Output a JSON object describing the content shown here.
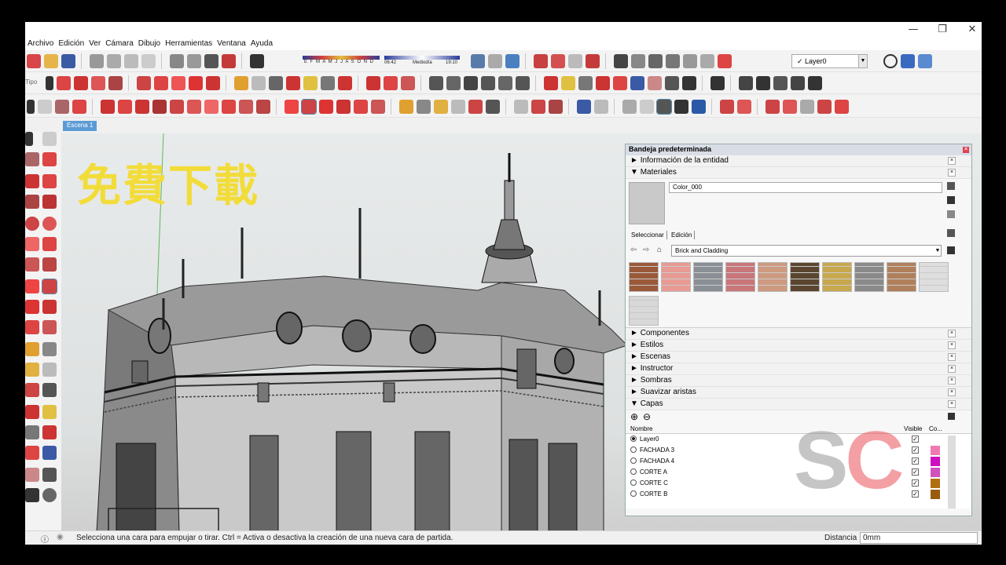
{
  "window": {
    "minimize": "—",
    "restore": "❐",
    "close": "✕"
  },
  "menu": [
    "Archivo",
    "Edición",
    "Ver",
    "Cámara",
    "Dibujo",
    "Herramientas",
    "Ventana",
    "Ayuda"
  ],
  "toolbar": {
    "tipo_label": "Tipo",
    "layer_select": "✓  Layer0",
    "shadow_months": "E F M A M J J A S O N D",
    "shadow_time_start": "06:42",
    "shadow_time_mid": "Mediodía",
    "shadow_time_end": "19:10"
  },
  "scene_tab": "Escena 1",
  "overlay": {
    "promo_text": "免費下載",
    "brand_text_s": "S",
    "brand_text_c": "C"
  },
  "tray": {
    "title": "Bandeja predeterminada",
    "sections": {
      "entity_info": "Información de la entidad",
      "materials": "Materiales",
      "components": "Componentes",
      "styles": "Estilos",
      "scenes": "Escenas",
      "instructor": "Instructor",
      "shadows": "Sombras",
      "soften_edges": "Suavizar aristas",
      "layers": "Capas"
    },
    "materials": {
      "current_name": "Color_000",
      "tab_select": "Seleccionar",
      "tab_edit": "Edición",
      "library": "Brick and Cladding",
      "swatches": [
        {
          "name": "brick-red",
          "color": "#9a5a3a"
        },
        {
          "name": "brick-pink",
          "color": "#e89a94"
        },
        {
          "name": "stone-blue-gray",
          "color": "#8a8f95"
        },
        {
          "name": "brick-rose",
          "color": "#c9767a"
        },
        {
          "name": "tile-tan",
          "color": "#cd9a80"
        },
        {
          "name": "brick-dark",
          "color": "#5a4630"
        },
        {
          "name": "brick-yellow",
          "color": "#c8a84e"
        },
        {
          "name": "stone-gray",
          "color": "#8a8a8a"
        },
        {
          "name": "wood-siding",
          "color": "#b0805c"
        },
        {
          "name": "siding-white",
          "color": "#dedede"
        },
        {
          "name": "concrete-white",
          "color": "#d8d8d8"
        }
      ]
    },
    "layers": {
      "col_name": "Nombre",
      "col_visible": "Visible",
      "col_color": "Co...",
      "rows": [
        {
          "name": "Layer0",
          "active": true,
          "color": "#ffffff"
        },
        {
          "name": "FACHADA 3",
          "active": false,
          "color": "#f07ab0"
        },
        {
          "name": "FACHADA 4",
          "active": false,
          "color": "#d010c0"
        },
        {
          "name": "CORTE A",
          "active": false,
          "color": "#d050c0"
        },
        {
          "name": "CORTE C",
          "active": false,
          "color": "#b07010"
        },
        {
          "name": "CORTE B",
          "active": false,
          "color": "#9a5a10"
        }
      ]
    }
  },
  "status": {
    "message": "Selecciona una cara para empujar o tirar. Ctrl = Activa o desactiva la creación de una nueva cara de partida.",
    "distance_label": "Distancia",
    "distance_value": "0mm"
  }
}
